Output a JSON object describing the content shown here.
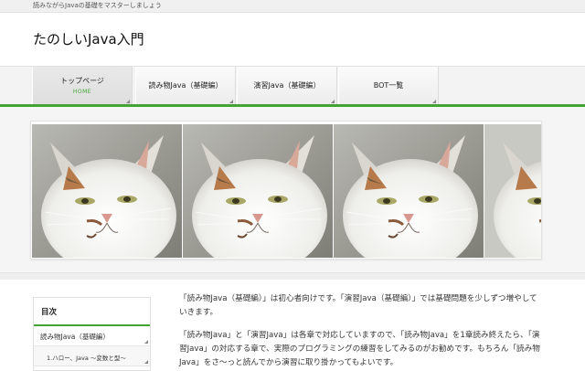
{
  "site": {
    "tagline": "読みながらJavaの基礎をマスターしましょう",
    "title": "たのしいJava入門"
  },
  "nav": {
    "items": [
      {
        "label": "トップページ",
        "sub": "HOME"
      },
      {
        "label": "読み物Java（基礎編）"
      },
      {
        "label": "演習Java（基礎編）"
      },
      {
        "label": "BOT一覧"
      }
    ]
  },
  "toc": {
    "title": "目次",
    "items": [
      {
        "label": "読み物Java（基礎編）"
      },
      {
        "label": "1.ハロー、Java ～変数と型～"
      }
    ]
  },
  "article": {
    "paragraphs": [
      "「読み物Java（基礎編）」は初心者向けです。「演習Java（基礎編）」では基礎問題を少しずつ増やしていきます。",
      "「読み物Java」と「演習Java」は各章で対応していますので、「読み物Java」を1章読み終えたら、「演習Java」の対応する章で、実際のプログラミングの練習をしてみるのがお勧めです。もちろん「読み物Java」をさ～っと読んでから演習に取り掛かってもよいです。"
    ]
  },
  "colors": {
    "accent": "#43a335",
    "background": "#f5f5f5"
  }
}
